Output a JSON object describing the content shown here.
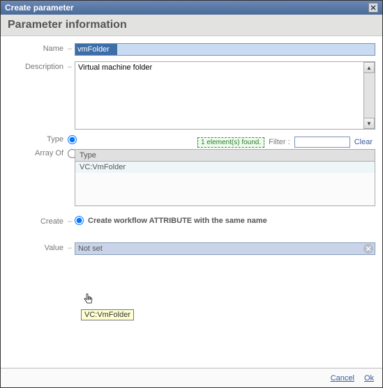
{
  "dialog": {
    "title": "Create parameter",
    "section_header": "Parameter information"
  },
  "fields": {
    "name_label": "Name",
    "name_value": "vmFolder",
    "description_label": "Description",
    "description_value": "Virtual machine folder",
    "type_label": "Type",
    "arrayof_label": "Array Of",
    "create_label": "Create",
    "create_option": "Create workflow ATTRIBUTE with the same name",
    "value_label": "Value",
    "value_text": "Not set"
  },
  "type_panel": {
    "found_text": "1 element(s) found.",
    "filter_label": "Filter :",
    "filter_value": "",
    "clear_label": "Clear",
    "column_header": "Type",
    "rows": [
      "VC:VmFolder"
    ]
  },
  "tooltip": "VC:VmFolder",
  "footer": {
    "cancel": "Cancel",
    "ok": "Ok"
  },
  "colors": {
    "title_bg": "#4a6a99",
    "accent": "#7a93b5",
    "value_bg": "#c9d4e8",
    "found_border": "#3a8a3a"
  }
}
